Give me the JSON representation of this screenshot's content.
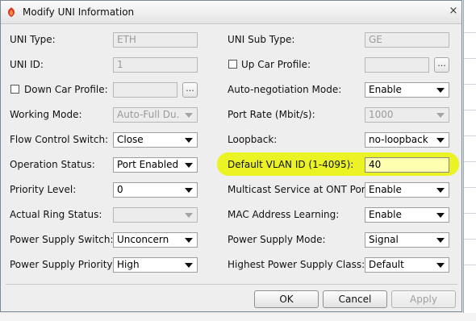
{
  "dialog": {
    "title": "Modify UNI Information",
    "close_label": "×"
  },
  "form": {
    "uni_type": {
      "label": "UNI Type:",
      "value": "ETH"
    },
    "uni_sub_type": {
      "label": "UNI Sub Type:",
      "value": "GE"
    },
    "uni_id": {
      "label": "UNI ID:",
      "value": "1"
    },
    "up_car_profile": {
      "label": "Up Car Profile:",
      "value": "",
      "button": "..."
    },
    "down_car_profile": {
      "label": "Down Car Profile:",
      "value": "",
      "button": "..."
    },
    "auto_negotiation_mode": {
      "label": "Auto-negotiation Mode:",
      "value": "Enable"
    },
    "working_mode": {
      "label": "Working Mode:",
      "value": "Auto-Full Du..."
    },
    "port_rate": {
      "label": "Port Rate (Mbit/s):",
      "value": "1000"
    },
    "flow_control_switch": {
      "label": "Flow Control Switch:",
      "value": "Close"
    },
    "loopback": {
      "label": "Loopback:",
      "value": "no-loopback"
    },
    "operation_status": {
      "label": "Operation Status:",
      "value": "Port Enabled"
    },
    "default_vlan_id": {
      "label": "Default VLAN ID (1-4095):",
      "value": "40"
    },
    "priority_level": {
      "label": "Priority Level:",
      "value": "0"
    },
    "multicast_service": {
      "label": "Multicast Service at ONT Port:",
      "value": "Enable"
    },
    "actual_ring_status": {
      "label": "Actual Ring Status:",
      "value": ""
    },
    "mac_address_learning": {
      "label": "MAC Address Learning:",
      "value": "Enable"
    },
    "power_supply_switch": {
      "label": "Power Supply Switch:",
      "value": "Unconcern"
    },
    "power_supply_mode": {
      "label": "Power Supply Mode:",
      "value": "Signal"
    },
    "power_supply_priority": {
      "label": "Power Supply Priority:",
      "value": "High"
    },
    "highest_power_supply_class": {
      "label": "Highest Power Supply Class:",
      "value": "Default"
    }
  },
  "buttons": {
    "ok": "OK",
    "cancel": "Cancel",
    "apply": "Apply"
  },
  "colors": {
    "highlight": "#ebf218",
    "title_bar": "#eeeeee"
  },
  "icons": {
    "app": "app-logo-icon",
    "close": "close-icon",
    "dropdown": "chevron-down-icon"
  }
}
